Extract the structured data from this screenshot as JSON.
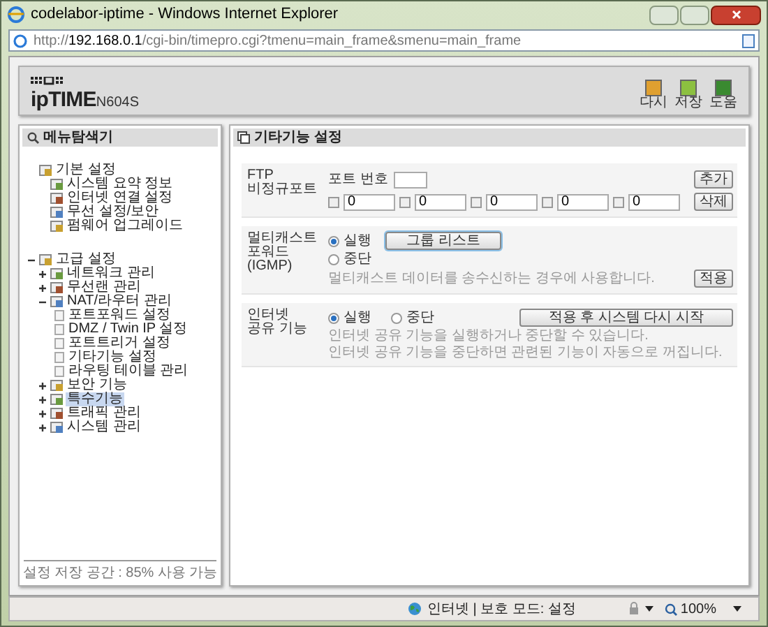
{
  "window": {
    "title": "codelabor-iptime - Windows Internet Explorer"
  },
  "address_bar": {
    "prefix": "http://",
    "host": "192.168.0.1",
    "path": "/cgi-bin/timepro.cgi?tmenu=main_frame&smenu=main_frame"
  },
  "header": {
    "logo_small": "ipTIME",
    "model": "N604S",
    "buttons": [
      {
        "label": "다시",
        "color": "#e0a030"
      },
      {
        "label": "저장",
        "color": "#8cc040"
      },
      {
        "label": "도움",
        "color": "#3a8a30"
      }
    ]
  },
  "sidebar": {
    "title": "메뉴탐색기",
    "tree": [
      {
        "label": "기본 설정",
        "selected": false,
        "children": [
          {
            "label": "시스템 요약 정보",
            "selected": false
          },
          {
            "label": "인터넷 연결 설정",
            "selected": false
          },
          {
            "label": "무선 설정/보안",
            "selected": false
          },
          {
            "label": "펌웨어 업그레이드",
            "selected": false
          }
        ]
      },
      {
        "label": "고급 설정",
        "selected": false,
        "expanded": true,
        "children": [
          {
            "label": "네트워크 관리",
            "selected": false,
            "expanded": false
          },
          {
            "label": "무선랜 관리",
            "selected": false,
            "expanded": false
          },
          {
            "label": "NAT/라우터 관리",
            "selected": false,
            "expanded": true,
            "children": [
              {
                "label": "포트포워드 설정",
                "selected": false
              },
              {
                "label": "DMZ / Twin IP 설정",
                "selected": false
              },
              {
                "label": "포트트리거 설정",
                "selected": false
              },
              {
                "label": "기타기능 설정",
                "selected": false
              },
              {
                "label": "라우팅 테이블 관리",
                "selected": false
              }
            ]
          },
          {
            "label": "보안 기능",
            "selected": false,
            "expanded": false
          },
          {
            "label": "특수기능",
            "selected": true,
            "expanded": false
          },
          {
            "label": "트래픽 관리",
            "selected": false,
            "expanded": false
          },
          {
            "label": "시스템 관리",
            "selected": false,
            "expanded": false
          }
        ]
      }
    ],
    "footer": "설정 저장 공간 : 85% 사용 가능"
  },
  "panel": {
    "title": "기타기능 설정",
    "ftp": {
      "label": [
        "FTP",
        "비정규포트"
      ],
      "port_label": "포트 번호",
      "add_button": "추가",
      "delete_button": "삭제",
      "ports": [
        {
          "value": "0",
          "checked": false
        },
        {
          "value": "0",
          "checked": false
        },
        {
          "value": "0",
          "checked": false
        },
        {
          "value": "0",
          "checked": false
        },
        {
          "value": "0",
          "checked": false
        }
      ]
    },
    "multicast": {
      "label": [
        "멀티캐스트",
        "포워드",
        "(IGMP)"
      ],
      "options": [
        {
          "label": "실행",
          "selected": true
        },
        {
          "label": "중단",
          "selected": false
        }
      ],
      "group_button": "그룹 리스트",
      "description": "멀티캐스트 데이터를 송수신하는 경우에 사용합니다.",
      "apply_button": "적용"
    },
    "sharing": {
      "label": [
        "인터넷",
        "공유 기능"
      ],
      "options": [
        {
          "label": "실행",
          "selected": true
        },
        {
          "label": "중단",
          "selected": false
        }
      ],
      "restart_button": "적용 후 시스템 다시 시작",
      "description": [
        "인터넷 공유 기능을 실행하거나 중단할 수 있습니다.",
        "인터넷 공유 기능을 중단하면 관련된 기능이 자동으로 꺼집니다."
      ]
    }
  },
  "status_bar": {
    "zone": "인터넷 | 보호 모드: 설정",
    "zoom": "100%"
  }
}
